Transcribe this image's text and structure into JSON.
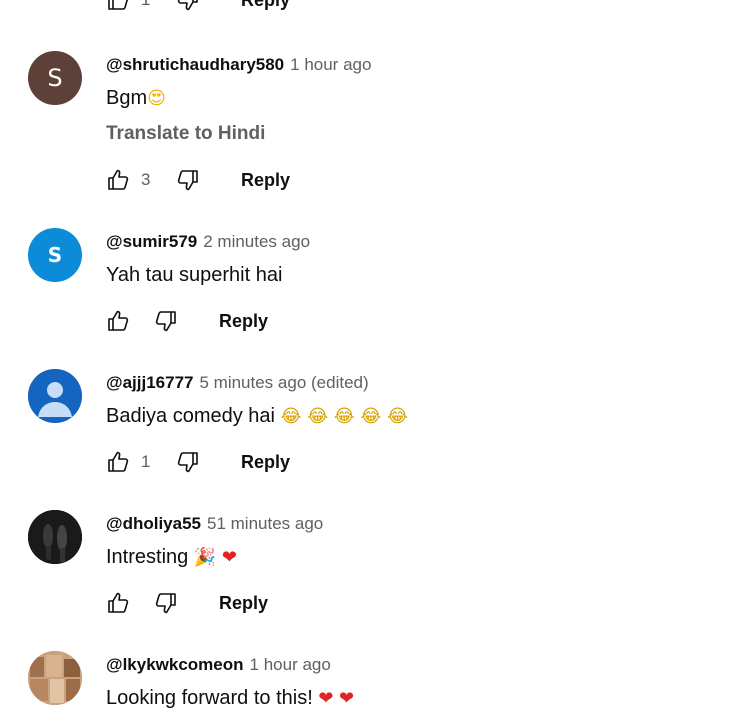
{
  "top_actions": {
    "like_count": "1",
    "reply_label": "Reply"
  },
  "comments": [
    {
      "avatar_letter": "S",
      "author": "@shrutichaudhary580",
      "time": "1 hour ago",
      "text": "Bgm",
      "emoji": [
        "heart-eyes-emoji"
      ],
      "translate_label": "Translate to Hindi",
      "like_count": "3",
      "reply_label": "Reply"
    },
    {
      "avatar_letter": "S",
      "author": "@sumir579",
      "time": "2 minutes ago",
      "text": "Yah tau superhit hai",
      "like_count": "",
      "reply_label": "Reply"
    },
    {
      "avatar_letter": "",
      "author": "@ajjj16777",
      "time": "5 minutes ago (edited)",
      "text": "Badiya comedy hai",
      "emoji": [
        "joy-emoji",
        "joy-emoji",
        "joy-emoji",
        "joy-emoji",
        "joy-emoji"
      ],
      "like_count": "1",
      "reply_label": "Reply"
    },
    {
      "avatar_letter": "",
      "author": "@dholiya55",
      "time": "51 minutes ago",
      "text": "Intresting",
      "emoji": [
        "party-popper-emoji",
        "red-heart-emoji"
      ],
      "like_count": "",
      "reply_label": "Reply"
    },
    {
      "avatar_letter": "",
      "author": "@lkykwkcomeon",
      "time": "1 hour ago",
      "text": "Looking forward to this!",
      "emoji": [
        "red-heart-emoji",
        "red-heart-emoji"
      ]
    }
  ],
  "colors": {
    "secondary_text": "#606060",
    "primary_text": "#0f0f0f",
    "avatar_brown": "#5d4037",
    "avatar_blue": "#0b8bd8",
    "avatar_default": "#1565c0"
  }
}
